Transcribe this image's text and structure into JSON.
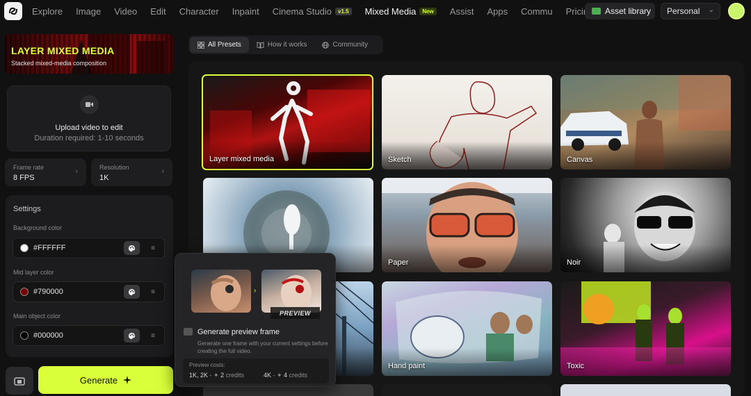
{
  "nav": {
    "items": [
      {
        "label": "Explore",
        "active": false
      },
      {
        "label": "Image",
        "active": false
      },
      {
        "label": "Video",
        "active": false
      },
      {
        "label": "Edit",
        "active": false
      },
      {
        "label": "Character",
        "active": false
      },
      {
        "label": "Inpaint",
        "active": false
      },
      {
        "label": "Cinema Studio",
        "badge": "v1.5",
        "active": false
      },
      {
        "label": "Mixed Media",
        "badge": "New",
        "active": true
      },
      {
        "label": "Assist",
        "active": false
      },
      {
        "label": "Apps",
        "active": false
      },
      {
        "label": "Commu",
        "active": false
      },
      {
        "label": "Pricing",
        "active": false
      }
    ],
    "asset_library": "Asset library",
    "workspace": "Personal"
  },
  "hero": {
    "title": "LAYER MIXED MEDIA",
    "subtitle": "Stacked mixed-media composition"
  },
  "upload": {
    "title": "Upload video to edit",
    "subtitle": "Duration required: 1-10 seconds"
  },
  "params": {
    "frame_rate": {
      "label": "Frame rate",
      "value": "8 FPS"
    },
    "resolution": {
      "label": "Resolution",
      "value": "1K"
    }
  },
  "settings": {
    "title": "Settings",
    "colors": [
      {
        "label": "Background color",
        "value": "#FFFFFF",
        "swatch": "#ffffff"
      },
      {
        "label": "Mid layer color",
        "value": "#790000",
        "swatch": "#790000"
      },
      {
        "label": "Main object color",
        "value": "#000000",
        "swatch": "#000000"
      }
    ]
  },
  "generate": {
    "label": "Generate"
  },
  "tabs": [
    {
      "label": "All Presets",
      "icon": "grid-icon",
      "active": true
    },
    {
      "label": "How it works",
      "icon": "book-icon",
      "active": false
    },
    {
      "label": "Community",
      "icon": "globe-icon",
      "active": false
    }
  ],
  "presets": [
    {
      "label": "Layer mixed media",
      "selected": true
    },
    {
      "label": "Sketch",
      "selected": false
    },
    {
      "label": "Canvas",
      "selected": false
    },
    {
      "label": "",
      "selected": false
    },
    {
      "label": "Paper",
      "selected": false
    },
    {
      "label": "Noir",
      "selected": false
    },
    {
      "label": "",
      "selected": false
    },
    {
      "label": "Hand paint",
      "selected": false
    },
    {
      "label": "Toxic",
      "selected": false
    }
  ],
  "preview": {
    "badge": "PREVIEW",
    "title": "Generate preview frame",
    "description": "Generate one frame with your current settings before creating the full video.",
    "costs_label": "Preview costs:",
    "cost_low": {
      "res": "1K, 2K",
      "credits": "2",
      "unit": "credits"
    },
    "cost_high": {
      "res": "4K",
      "credits": "4",
      "unit": "credits"
    }
  },
  "colors": {
    "accent": "#d8ff3a",
    "background": "#111112"
  }
}
